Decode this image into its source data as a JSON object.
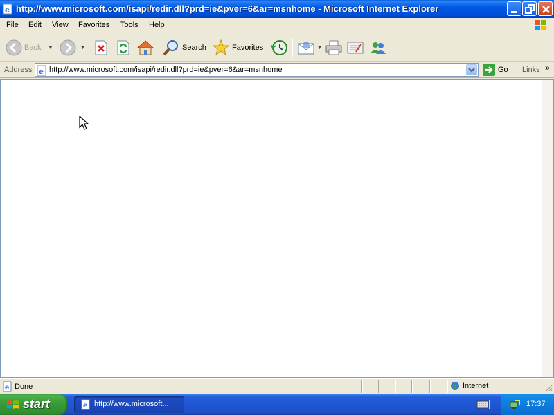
{
  "window": {
    "title": "http://www.microsoft.com/isapi/redir.dll?prd=ie&pver=6&ar=msnhome - Microsoft Internet Explorer"
  },
  "menu": {
    "items": [
      "File",
      "Edit",
      "View",
      "Favorites",
      "Tools",
      "Help"
    ]
  },
  "toolbar": {
    "back_label": "Back",
    "search_label": "Search",
    "favorites_label": "Favorites"
  },
  "address": {
    "label": "Address",
    "url": "http://www.microsoft.com/isapi/redir.dll?prd=ie&pver=6&ar=msnhome",
    "go_label": "Go",
    "links_label": "Links"
  },
  "status": {
    "text": "Done",
    "zone": "Internet"
  },
  "taskbar": {
    "start_label": "start",
    "task_item_label": "http://www.microsoft...",
    "clock": "17:37"
  },
  "colors": {
    "titlebar": "#0058e6",
    "taskbar": "#245edb",
    "start_button": "#3a9d3a",
    "tray": "#0f80e0"
  },
  "icons": {
    "back": "back-arrow-icon",
    "forward": "forward-arrow-icon",
    "stop": "stop-icon",
    "refresh": "refresh-icon",
    "home": "home-icon",
    "search": "magnifier-icon",
    "favorites": "star-icon",
    "history": "history-icon",
    "mail": "mail-icon",
    "print": "printer-icon",
    "edit": "edit-icon",
    "messenger": "messenger-icon"
  }
}
